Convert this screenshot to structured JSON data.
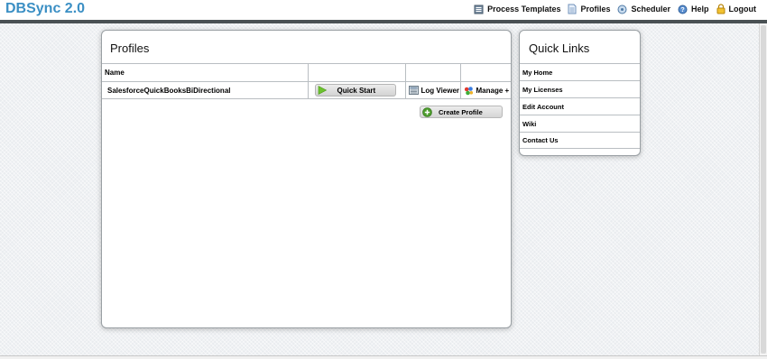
{
  "app": {
    "title": "DBSync 2.0"
  },
  "topnav": {
    "items": [
      {
        "label": "Process Templates",
        "icon": "process-templates-icon"
      },
      {
        "label": "Profiles",
        "icon": "profiles-icon"
      },
      {
        "label": "Scheduler",
        "icon": "scheduler-icon"
      },
      {
        "label": "Help",
        "icon": "help-icon"
      },
      {
        "label": "Logout",
        "icon": "lock-icon"
      }
    ]
  },
  "profiles": {
    "title": "Profiles",
    "columns": {
      "name": "Name"
    },
    "rows": [
      {
        "name": "SalesforceQuickBooksBiDirectional",
        "quick_start": "Quick Start",
        "log_viewer": "Log Viewer",
        "manage": "Manage +"
      }
    ],
    "create_profile": "Create Profile"
  },
  "quick_links": {
    "title": "Quick Links",
    "items": [
      "My Home",
      "My Licenses",
      "Edit Account",
      "Wiki",
      "Contact Us"
    ]
  },
  "colors": {
    "logo": "#3b8fc4",
    "stripe": "#4a5154",
    "play_green": "#6cc22e"
  }
}
